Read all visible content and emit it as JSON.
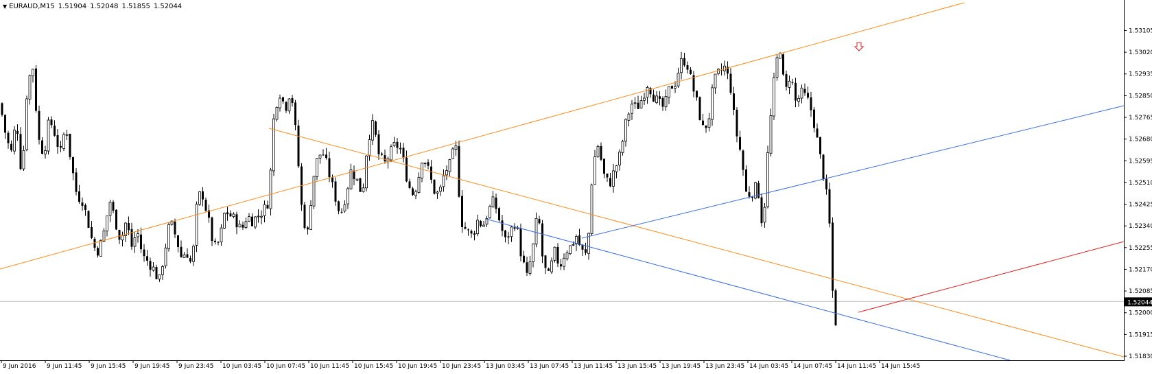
{
  "header": {
    "symbol_timeframe": "EURAUD,M15",
    "open": "1.51904",
    "high": "1.52048",
    "low": "1.51855",
    "close": "1.52044",
    "menu_icon": "triangle-down-icon"
  },
  "current_price_label": "1.52044",
  "chart_data": {
    "type": "candlestick",
    "symbol": "EURAUD",
    "timeframe": "M15",
    "y_ticks": [
      "1.53105",
      "1.53020",
      "1.52935",
      "1.52850",
      "1.52765",
      "1.52680",
      "1.52595",
      "1.52510",
      "1.52425",
      "1.52340",
      "1.52255",
      "1.52170",
      "1.52085",
      "1.52000",
      "1.51915",
      "1.51830"
    ],
    "x_ticks": [
      "9 Jun 2016",
      "9 Jun 11:45",
      "9 Jun 15:45",
      "9 Jun 19:45",
      "9 Jun 23:45",
      "10 Jun 03:45",
      "10 Jun 07:45",
      "10 Jun 11:45",
      "10 Jun 15:45",
      "10 Jun 19:45",
      "10 Jun 23:45",
      "13 Jun 03:45",
      "13 Jun 07:45",
      "13 Jun 11:45",
      "13 Jun 15:45",
      "13 Jun 19:45",
      "13 Jun 23:45",
      "14 Jun 03:45",
      "14 Jun 07:45",
      "14 Jun 11:45",
      "14 Jun 15:45"
    ],
    "ylim": [
      1.5183,
      1.5316
    ],
    "current_price": 1.52044,
    "grid": false,
    "colors": {
      "candle": "#000000",
      "orange_channel": "#ff8c1a",
      "blue_channel": "#3a6fe0",
      "red_line": "#e52020",
      "price_line": "#c0c0c0",
      "arrow": "#e52020"
    },
    "price_path": [
      [
        0,
        1.5282
      ],
      [
        8,
        1.527
      ],
      [
        16,
        1.5262
      ],
      [
        24,
        1.5276
      ],
      [
        32,
        1.5252
      ],
      [
        40,
        1.529
      ],
      [
        48,
        1.5296
      ],
      [
        56,
        1.5268
      ],
      [
        64,
        1.5262
      ],
      [
        72,
        1.5276
      ],
      [
        80,
        1.527
      ],
      [
        88,
        1.5262
      ],
      [
        96,
        1.5274
      ],
      [
        104,
        1.5258
      ],
      [
        112,
        1.5246
      ],
      [
        120,
        1.5244
      ],
      [
        128,
        1.5236
      ],
      [
        136,
        1.5226
      ],
      [
        144,
        1.5224
      ],
      [
        152,
        1.5232
      ],
      [
        160,
        1.5244
      ],
      [
        168,
        1.5236
      ],
      [
        176,
        1.5228
      ],
      [
        184,
        1.5236
      ],
      [
        192,
        1.5226
      ],
      [
        200,
        1.5232
      ],
      [
        208,
        1.5222
      ],
      [
        216,
        1.522
      ],
      [
        224,
        1.5217
      ],
      [
        232,
        1.5212
      ],
      [
        240,
        1.5224
      ],
      [
        248,
        1.5236
      ],
      [
        256,
        1.523
      ],
      [
        264,
        1.5222
      ],
      [
        272,
        1.5224
      ],
      [
        280,
        1.5218
      ],
      [
        288,
        1.5246
      ],
      [
        296,
        1.5246
      ],
      [
        304,
        1.5236
      ],
      [
        312,
        1.5225
      ],
      [
        320,
        1.5228
      ],
      [
        328,
        1.524
      ],
      [
        336,
        1.5238
      ],
      [
        344,
        1.5236
      ],
      [
        352,
        1.5232
      ],
      [
        360,
        1.5238
      ],
      [
        368,
        1.5236
      ],
      [
        376,
        1.5238
      ],
      [
        384,
        1.524
      ],
      [
        392,
        1.5244
      ],
      [
        400,
        1.528
      ],
      [
        408,
        1.5286
      ],
      [
        416,
        1.528
      ],
      [
        424,
        1.5288
      ],
      [
        432,
        1.5268
      ],
      [
        440,
        1.524
      ],
      [
        448,
        1.523
      ],
      [
        456,
        1.5252
      ],
      [
        464,
        1.5262
      ],
      [
        472,
        1.5262
      ],
      [
        480,
        1.5254
      ],
      [
        488,
        1.5246
      ],
      [
        496,
        1.5238
      ],
      [
        504,
        1.5246
      ],
      [
        512,
        1.5256
      ],
      [
        520,
        1.5252
      ],
      [
        528,
        1.5246
      ],
      [
        536,
        1.5268
      ],
      [
        544,
        1.5274
      ],
      [
        552,
        1.5262
      ],
      [
        560,
        1.5258
      ],
      [
        568,
        1.5262
      ],
      [
        576,
        1.5266
      ],
      [
        584,
        1.5264
      ],
      [
        592,
        1.5254
      ],
      [
        600,
        1.5246
      ],
      [
        608,
        1.525
      ],
      [
        616,
        1.5262
      ],
      [
        624,
        1.5256
      ],
      [
        632,
        1.5248
      ],
      [
        640,
        1.5246
      ],
      [
        648,
        1.5255
      ],
      [
        656,
        1.5258
      ],
      [
        664,
        1.5266
      ],
      [
        672,
        1.5236
      ],
      [
        680,
        1.5232
      ],
      [
        688,
        1.523
      ],
      [
        696,
        1.5236
      ],
      [
        704,
        1.5234
      ],
      [
        712,
        1.524
      ],
      [
        720,
        1.5244
      ],
      [
        728,
        1.5236
      ],
      [
        736,
        1.5228
      ],
      [
        744,
        1.5232
      ],
      [
        752,
        1.5236
      ],
      [
        760,
        1.5222
      ],
      [
        768,
        1.5214
      ],
      [
        776,
        1.5224
      ],
      [
        784,
        1.524
      ],
      [
        792,
        1.5218
      ],
      [
        800,
        1.5214
      ],
      [
        808,
        1.5224
      ],
      [
        816,
        1.5218
      ],
      [
        824,
        1.5224
      ],
      [
        832,
        1.5226
      ],
      [
        840,
        1.523
      ],
      [
        848,
        1.5224
      ],
      [
        856,
        1.5222
      ],
      [
        864,
        1.5258
      ],
      [
        872,
        1.5266
      ],
      [
        880,
        1.5254
      ],
      [
        888,
        1.525
      ],
      [
        896,
        1.5256
      ],
      [
        904,
        1.5262
      ],
      [
        912,
        1.5274
      ],
      [
        920,
        1.5282
      ],
      [
        928,
        1.528
      ],
      [
        936,
        1.5284
      ],
      [
        944,
        1.529
      ],
      [
        952,
        1.5285
      ],
      [
        960,
        1.5282
      ],
      [
        968,
        1.528
      ],
      [
        976,
        1.5288
      ],
      [
        984,
        1.529
      ],
      [
        992,
        1.5298
      ],
      [
        1000,
        1.5299
      ],
      [
        1008,
        1.529
      ],
      [
        1016,
        1.5282
      ],
      [
        1024,
        1.5272
      ],
      [
        1032,
        1.5274
      ],
      [
        1040,
        1.529
      ],
      [
        1048,
        1.5294
      ],
      [
        1056,
        1.5296
      ],
      [
        1064,
        1.529
      ],
      [
        1072,
        1.5272
      ],
      [
        1080,
        1.5262
      ],
      [
        1088,
        1.5246
      ],
      [
        1096,
        1.5247
      ],
      [
        1104,
        1.525
      ],
      [
        1112,
        1.5232
      ],
      [
        1120,
        1.5266
      ],
      [
        1128,
        1.529
      ],
      [
        1136,
        1.5306
      ],
      [
        1144,
        1.5285
      ],
      [
        1152,
        1.5294
      ],
      [
        1160,
        1.5282
      ],
      [
        1168,
        1.5286
      ],
      [
        1176,
        1.5284
      ],
      [
        1184,
        1.5278
      ],
      [
        1192,
        1.5266
      ],
      [
        1200,
        1.5254
      ],
      [
        1208,
        1.524
      ],
      [
        1216,
        1.5194
      ],
      [
        1224,
        1.5204
      ]
    ]
  }
}
